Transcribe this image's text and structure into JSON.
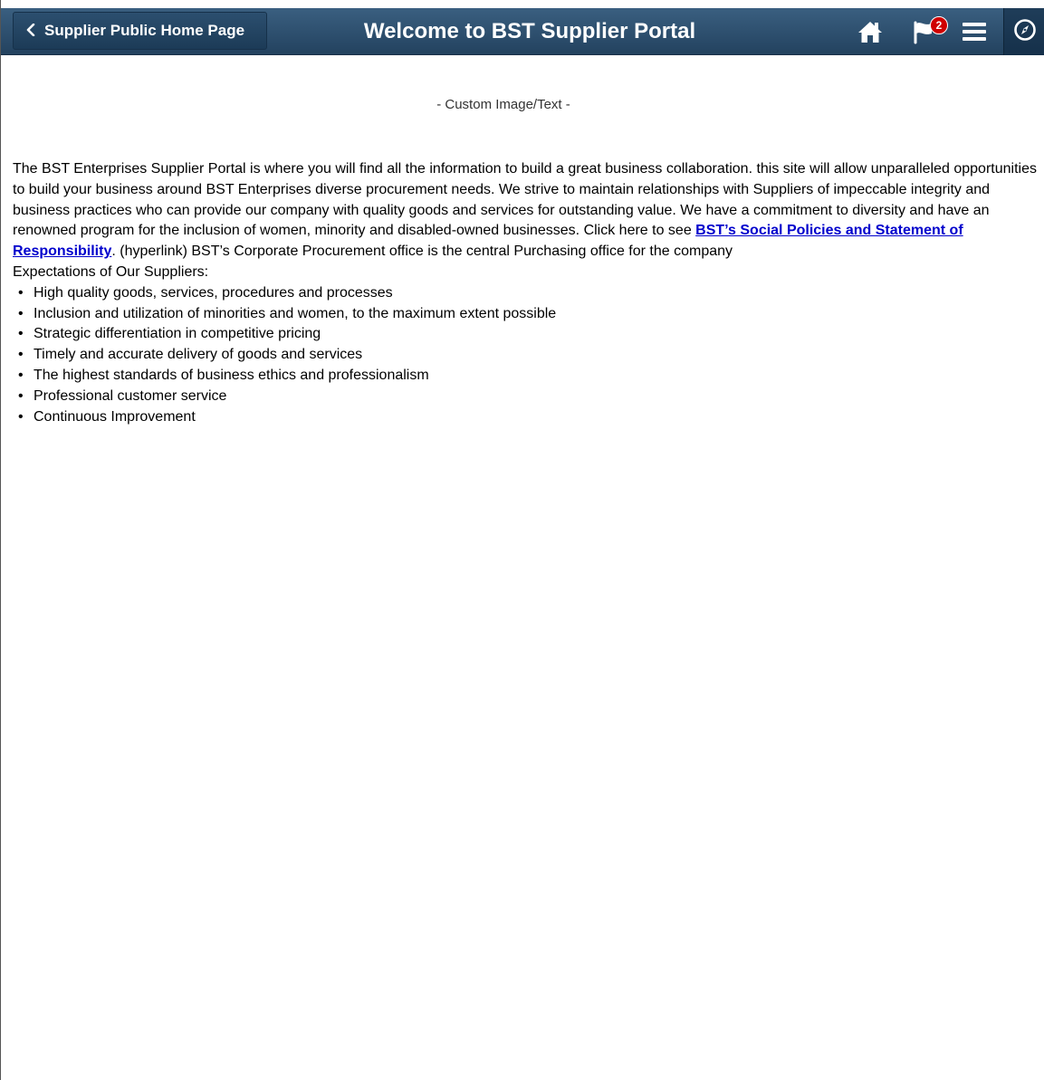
{
  "header": {
    "back_label": "Supplier Public Home Page",
    "title": "Welcome to BST Supplier Portal",
    "notifications_count": "2",
    "icons": {
      "back": "chevron-left-icon",
      "home": "home-icon",
      "notifications": "flag-icon",
      "menu": "hamburger-menu-icon",
      "navbar": "compass-icon"
    },
    "colors": {
      "banner": "#2f5273",
      "badge": "#d00000"
    }
  },
  "main": {
    "custom_text": "- Custom Image/Text -",
    "intro_before_link": "The BST Enterprises Supplier Portal is where you will find all the information to build a great business collaboration.  this site will allow unparalleled opportunities to build your business around BST Enterprises diverse procurement needs.  We strive to maintain relationships with Suppliers of impeccable integrity and business practices who can provide our company with quality goods and services for outstanding value. We have a commitment to diversity and have an renowned program for the inclusion of women, minority and disabled-owned businesses.  Click here to see ",
    "link_label": "BST’s Social Policies and Statement of Responsibility",
    "intro_after_link": ". (hyperlink)  BST’s Corporate Procurement office is the central Purchasing office for the company",
    "expectations_heading": "Expectations of Our Suppliers:",
    "bullet_char": "•",
    "expectations": [
      "High quality goods, services, procedures and processes",
      "Inclusion and utilization of minorities and women, to the maximum extent possible",
      "Strategic differentiation in competitive pricing",
      "Timely and accurate delivery of goods and services",
      "The highest standards of business ethics and professionalism",
      "Professional customer service",
      "Continuous Improvement"
    ]
  }
}
